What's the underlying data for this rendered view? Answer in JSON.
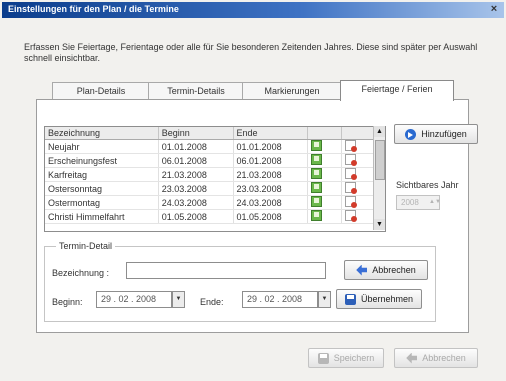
{
  "window": {
    "title": "Einstellungen für den Plan / die Termine",
    "close_glyph": "×"
  },
  "description": "Erfassen Sie Feiertage, Ferientage oder alle für Sie besonderen Zeitenden Jahres. Diese sind später per Auswahl schnell einsichtbar.",
  "tabs": [
    {
      "label": "Plan-Details",
      "active": false
    },
    {
      "label": "Termin-Details",
      "active": false
    },
    {
      "label": "Markierungen",
      "active": false
    },
    {
      "label": "Feiertage / Ferien",
      "active": true
    }
  ],
  "grid": {
    "columns": [
      "Bezeichnung",
      "Beginn",
      "Ende",
      "",
      ""
    ],
    "rows": [
      {
        "name": "Neujahr",
        "start": "01.01.2008",
        "end": "01.01.2008"
      },
      {
        "name": "Erscheinungsfest",
        "start": "06.01.2008",
        "end": "06.01.2008"
      },
      {
        "name": "Karfreitag",
        "start": "21.03.2008",
        "end": "21.03.2008"
      },
      {
        "name": "Ostersonntag",
        "start": "23.03.2008",
        "end": "23.03.2008"
      },
      {
        "name": "Ostermontag",
        "start": "24.03.2008",
        "end": "24.03.2008"
      },
      {
        "name": "Christi Himmelfahrt",
        "start": "01.05.2008",
        "end": "01.05.2008"
      }
    ]
  },
  "buttons": {
    "add": "Hinzufügen",
    "cancel": "Abbrechen",
    "apply": "Übernehmen",
    "save": "Speichern",
    "footer_cancel": "Abbrechen"
  },
  "visible_year": {
    "label": "Sichtbares Jahr",
    "value": "2008"
  },
  "detail": {
    "legend": "Termin-Detail",
    "name_label": "Bezeichnung :",
    "name_value": "",
    "start_label": "Beginn:",
    "start_value": "29 . 02 . 2008",
    "end_label": "Ende:",
    "end_value": "29 . 02 . 2008"
  },
  "icons": {
    "add": "add-arrow-icon",
    "cancel": "back-arrow-icon",
    "save": "floppy-disk-icon",
    "edit": "edit-icon",
    "delete": "delete-icon"
  }
}
